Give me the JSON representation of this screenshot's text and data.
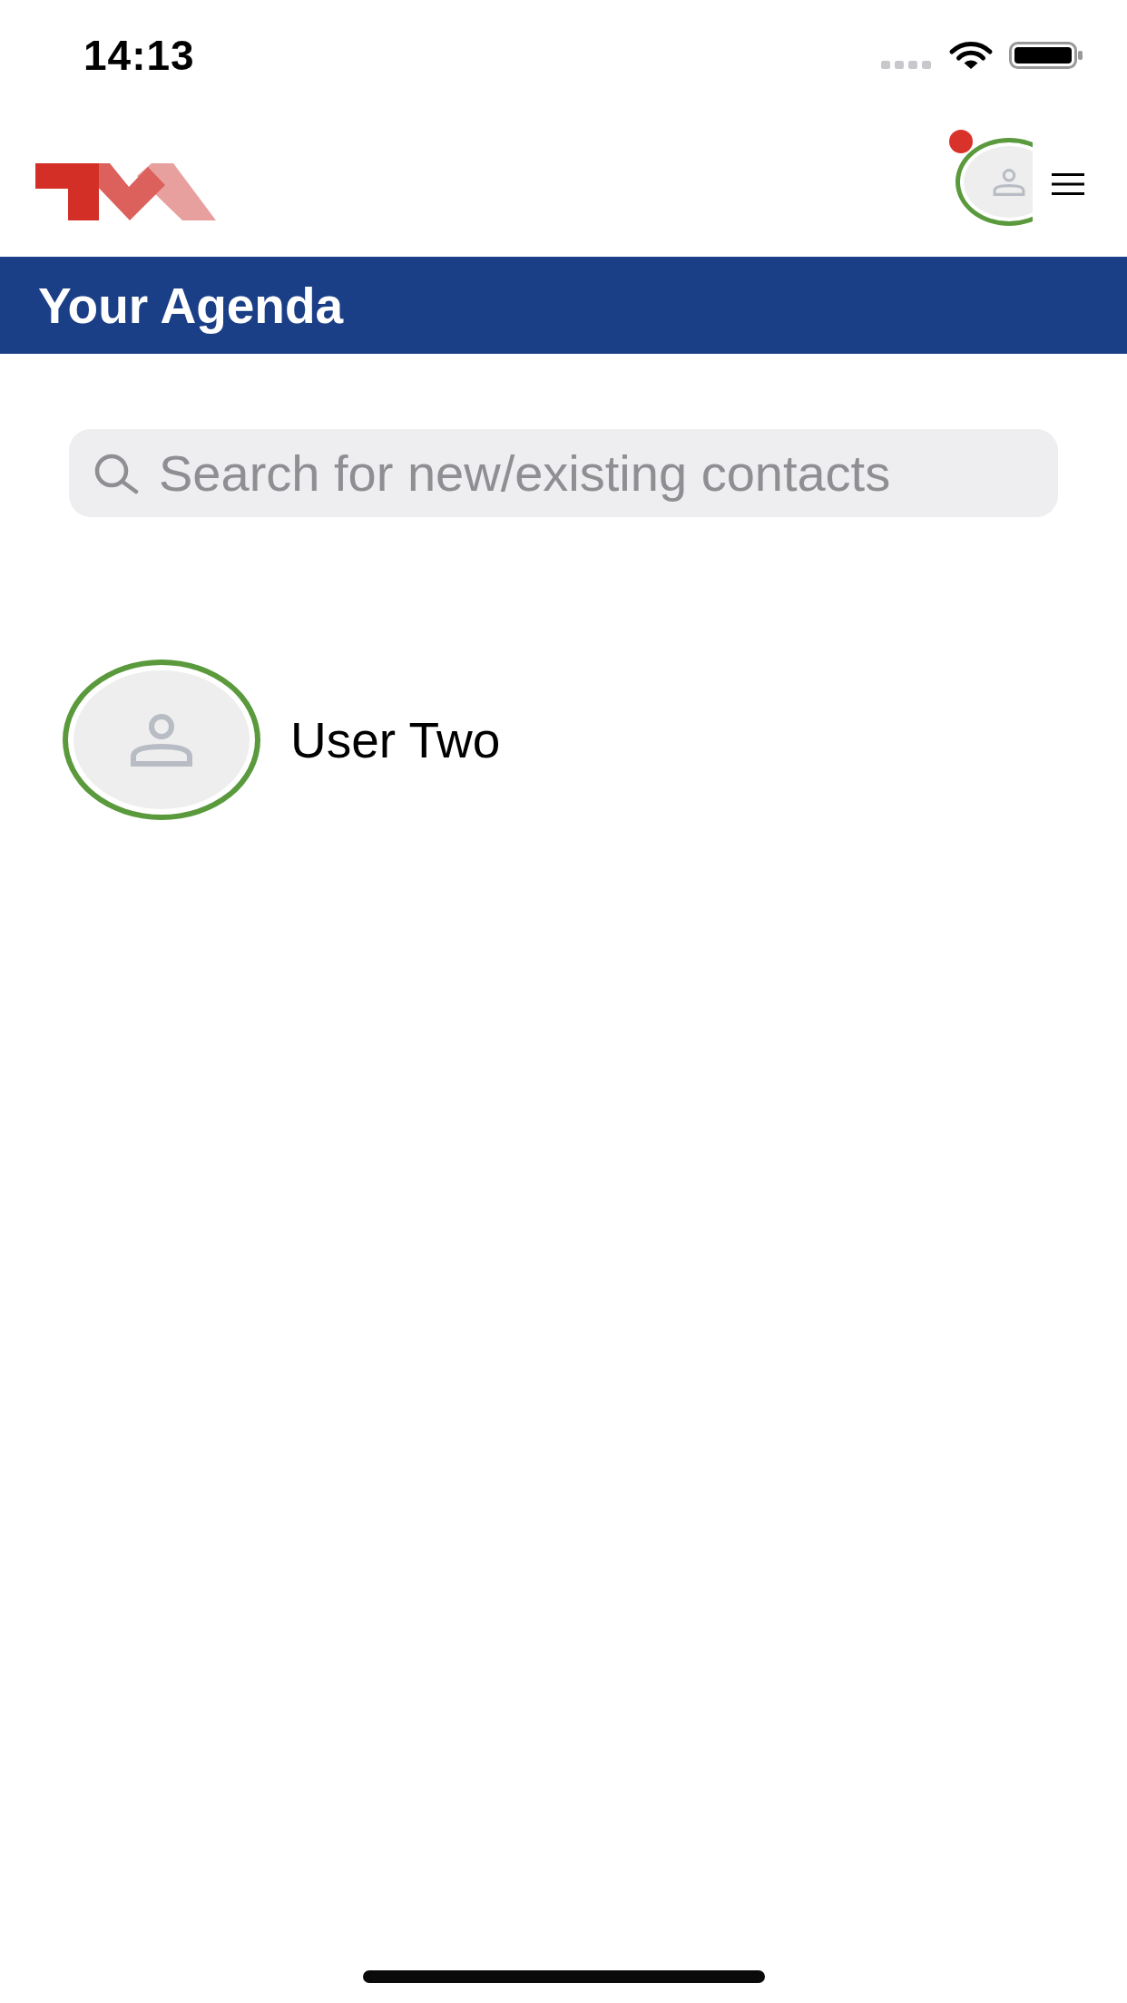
{
  "status_bar": {
    "time": "14:13"
  },
  "header": {
    "profile": {
      "online": true,
      "has_notification": true
    }
  },
  "title_bar": {
    "title": "Your Agenda"
  },
  "search": {
    "placeholder": "Search for new/existing contacts"
  },
  "contacts": [
    {
      "name": "User Two",
      "online": true
    }
  ]
}
